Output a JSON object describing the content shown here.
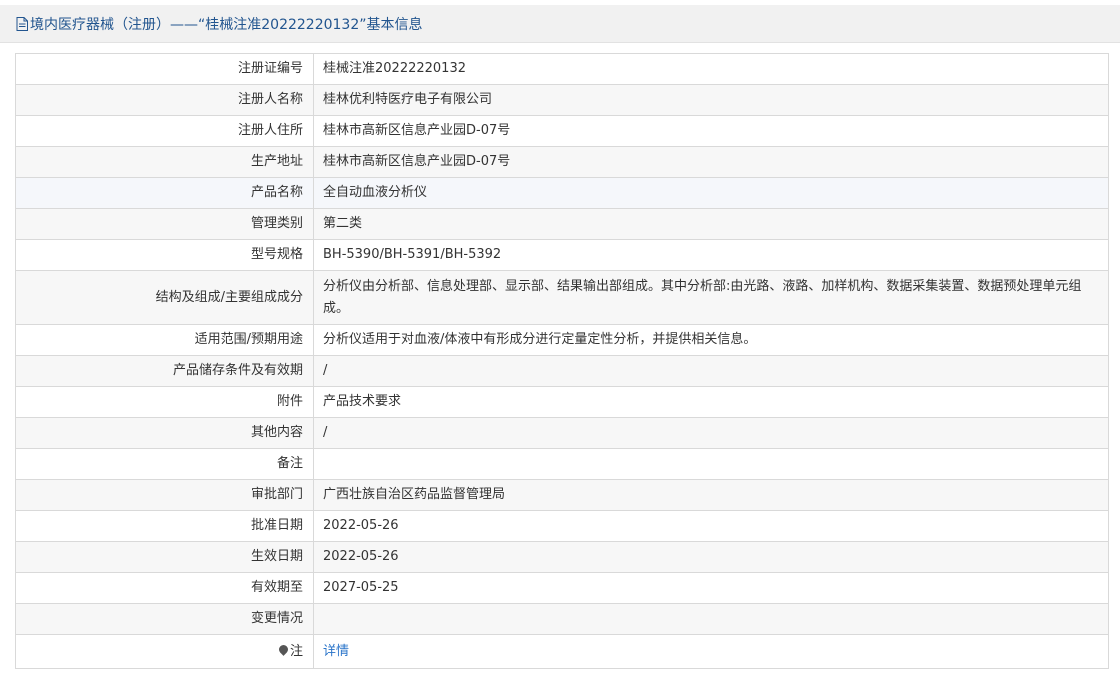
{
  "header": {
    "title": "境内医疗器械（注册）——“桂械注准20222220132”基本信息",
    "icon": "document-icon"
  },
  "rows": [
    {
      "label": "注册证编号",
      "value": "桂械注准20222220132"
    },
    {
      "label": "注册人名称",
      "value": "桂林优利特医疗电子有限公司"
    },
    {
      "label": "注册人住所",
      "value": "桂林市高新区信息产业园D-07号"
    },
    {
      "label": "生产地址",
      "value": "桂林市高新区信息产业园D-07号"
    },
    {
      "label": "产品名称",
      "value": "全自动血液分析仪"
    },
    {
      "label": "管理类别",
      "value": "第二类"
    },
    {
      "label": "型号规格",
      "value": "BH-5390/BH-5391/BH-5392"
    },
    {
      "label": "结构及组成/主要组成成分",
      "value": "分析仪由分析部、信息处理部、显示部、结果输出部组成。其中分析部:由光路、液路、加样机构、数据采集装置、数据预处理单元组成。"
    },
    {
      "label": "适用范围/预期用途",
      "value": "分析仪适用于对血液/体液中有形成分进行定量定性分析，并提供相关信息。"
    },
    {
      "label": "产品储存条件及有效期",
      "value": "/"
    },
    {
      "label": "附件",
      "value": "产品技术要求"
    },
    {
      "label": "其他内容",
      "value": "/"
    },
    {
      "label": "备注",
      "value": ""
    },
    {
      "label": "审批部门",
      "value": "广西壮族自治区药品监督管理局"
    },
    {
      "label": "批准日期",
      "value": "2022-05-26"
    },
    {
      "label": "生效日期",
      "value": "2022-05-26"
    },
    {
      "label": "有效期至",
      "value": "2027-05-25"
    },
    {
      "label": "变更情况",
      "value": ""
    }
  ],
  "note_row": {
    "label": "注",
    "link": "详情",
    "icon": "pin-icon"
  },
  "colors": {
    "header_bg": "#f1f1f1",
    "title": "#22558f",
    "border": "#d9d9d9",
    "stripe": "#f7f7f7",
    "link": "#2a74c9"
  }
}
